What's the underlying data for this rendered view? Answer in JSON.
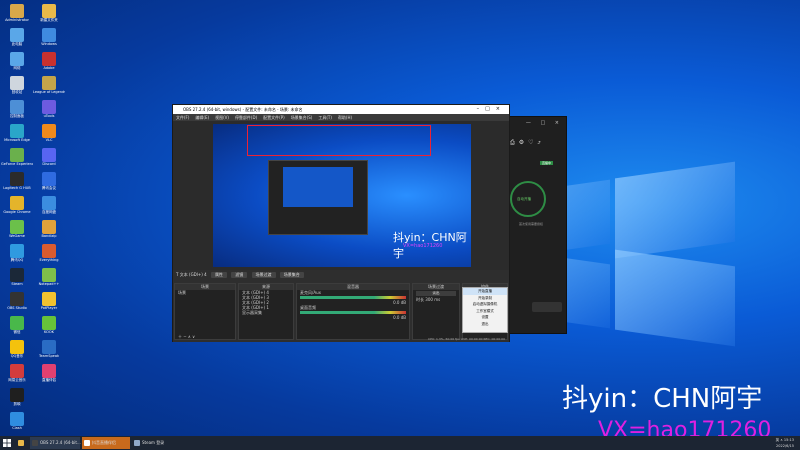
{
  "desktop": {
    "icons": [
      {
        "label": "Administrator",
        "color": "#d9a84a"
      },
      {
        "label": "此电脑",
        "color": "#5aa7e8"
      },
      {
        "label": "网络",
        "color": "#5aa7e8"
      },
      {
        "label": "回收站",
        "color": "#cfd6de"
      },
      {
        "label": "控制面板",
        "color": "#4d8fd6"
      },
      {
        "label": "Microsoft Edge",
        "color": "#2aa6c9"
      },
      {
        "label": "GeForce Experience",
        "color": "#6ab04c"
      },
      {
        "label": "Logitech G HUB",
        "color": "#2b2b2b"
      },
      {
        "label": "Google Chrome",
        "color": "#e4b42b"
      },
      {
        "label": "WeGame",
        "color": "#6bc04a"
      },
      {
        "label": "腾讯QQ",
        "color": "#2f9ae0"
      },
      {
        "label": "Steam",
        "color": "#1b2838"
      },
      {
        "label": "OBS Studio",
        "color": "#333333"
      },
      {
        "label": "微信",
        "color": "#49b84a"
      },
      {
        "label": "QQ音乐",
        "color": "#f4c20d"
      },
      {
        "label": "网易云音乐",
        "color": "#d23c3c"
      },
      {
        "label": "剪映",
        "color": "#1f1f1f"
      },
      {
        "label": "Clash",
        "color": "#2f8de0"
      }
    ],
    "icons_col2": [
      {
        "label": "新建文件夹",
        "color": "#e9b949"
      },
      {
        "label": "Windows",
        "color": "#3f8be0"
      },
      {
        "label": "Adobe",
        "color": "#c8312f"
      },
      {
        "label": "League of Legends",
        "color": "#c3a44a"
      },
      {
        "label": "uTools",
        "color": "#6d5be0"
      },
      {
        "label": "VLC",
        "color": "#f08a1c"
      },
      {
        "label": "Discord",
        "color": "#5865f2"
      },
      {
        "label": "腾讯会议",
        "color": "#2f6be0"
      },
      {
        "label": "百度网盘",
        "color": "#3b8de0"
      },
      {
        "label": "Bandizip",
        "color": "#e0a13b"
      },
      {
        "label": "Everything",
        "color": "#d95b2f"
      },
      {
        "label": "Notepad++",
        "color": "#7fbf4a"
      },
      {
        "label": "PotPlayer",
        "color": "#f2c230"
      },
      {
        "label": "KOOK",
        "color": "#67c23a"
      },
      {
        "label": "TeamSpeak",
        "color": "#2a6cc4"
      },
      {
        "label": "直播伴侣",
        "color": "#e04070"
      }
    ]
  },
  "obs": {
    "title": "OBS 27.2.4 (64-bit, windows) - 配置文件: 未命名 - 场景: 未命名",
    "menu": [
      "文件(F)",
      "编辑(E)",
      "视图(V)",
      "停靠部件(D)",
      "配置文件(P)",
      "场景集合(S)",
      "工具(T)",
      "帮助(H)"
    ],
    "preview_caption": "抖yin：CHN阿宇",
    "preview_sub": "VX=hao171260",
    "source_bar": {
      "source_name": "文本 (GDI+) 4",
      "buttons": [
        "属性",
        "滤镜"
      ]
    },
    "tabs": [
      "场景过渡",
      "场景集合"
    ],
    "docks": {
      "scenes": {
        "title": "场景",
        "items": [
          "场景"
        ]
      },
      "sources": {
        "title": "来源",
        "items": [
          "文本 (GDI+) 4",
          "文本 (GDI+) 3",
          "文本 (GDI+) 2",
          "文本 (GDI+) 1",
          "显示器采集"
        ]
      },
      "mixer": {
        "title": "混音器",
        "channels": [
          {
            "name": "麦克风/Aux",
            "db": "0.0 dB"
          },
          {
            "name": "桌面音频",
            "db": "0.0 dB"
          }
        ]
      },
      "transitions": {
        "title": "场景过渡",
        "type": "淡出",
        "duration_label": "时长",
        "duration": "300 ms"
      },
      "controls": {
        "title": "控件",
        "buttons": [
          "开始直播",
          "开始录制",
          "启动虚拟摄像机",
          "工作室模式",
          "设置",
          "退出"
        ]
      }
    },
    "status": "CPU: 1.3%, 60.00 fps   LIVE: 00:00:00   REC: 00:00:00"
  },
  "dark_app": {
    "badge": "直播中",
    "circle_label": "自动开播",
    "sub": "首次使用需要授权",
    "window_controls": "— □ ×"
  },
  "context_menu": {
    "items": [
      "开始直播",
      "开始录制",
      "启动虚拟摄像机",
      "工作室模式",
      "设置",
      "退出"
    ],
    "highlighted": 0
  },
  "overlay": {
    "main_text": "抖yin：CHN阿宇",
    "vx_text": "VX=hao171260",
    "vx_color": "#e020e0"
  },
  "taskbar": {
    "items": [
      {
        "label": "OBS 27.2.4 (64-bit...",
        "color": "#444444"
      },
      {
        "label": "抖音直播伴侣",
        "color": "#e07020"
      },
      {
        "label": "Steam 登录",
        "color": "#1b2838"
      }
    ],
    "tray_line1": "英 ∧ 15:13",
    "tray_line2": "2022/6/15"
  }
}
